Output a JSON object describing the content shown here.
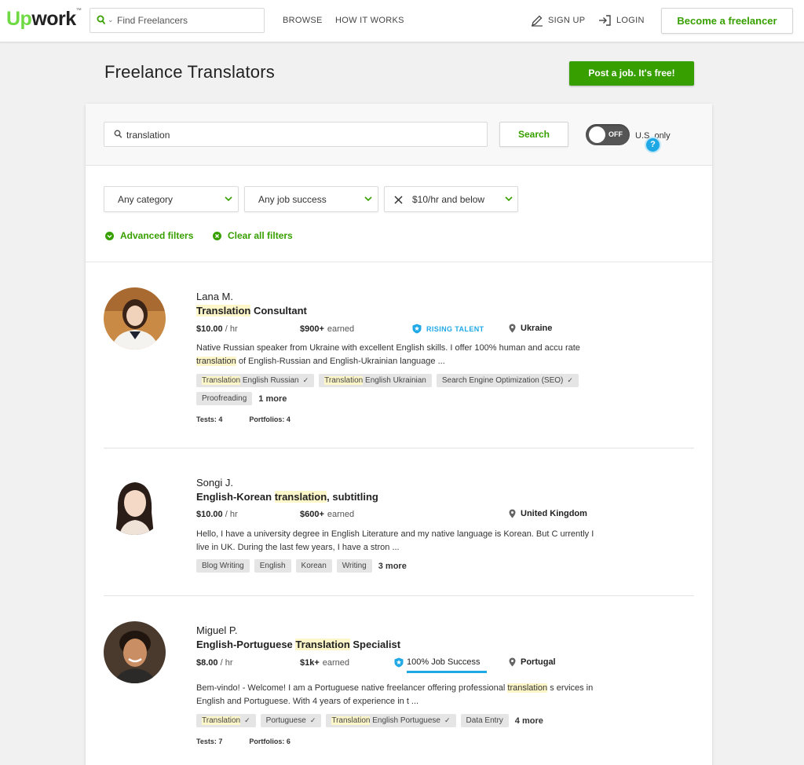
{
  "header": {
    "logo_up": "Up",
    "logo_work": "work",
    "logo_tm": "™",
    "search_placeholder": "Find Freelancers",
    "nav_browse": "BROWSE",
    "nav_how": "HOW IT WORKS",
    "signup": "SIGN UP",
    "login": "LOGIN",
    "become": "Become a freelancer"
  },
  "page": {
    "title": "Freelance Translators",
    "post_job": "Post a job. It's free!"
  },
  "search": {
    "value": "translation",
    "button": "Search",
    "toggle_state": "OFF",
    "us_only": "U.S. only",
    "help": "?"
  },
  "filters": {
    "category": "Any category",
    "job_success": "Any job success",
    "rate": "$10/hr and below",
    "advanced": "Advanced filters",
    "clear": "Clear all filters"
  },
  "freelancers": [
    {
      "name": "Lana M.",
      "title_hl": "Translation",
      "title_rest": " Consultant",
      "rate": "$10.00",
      "rate_unit": " / hr",
      "earned": "$900+",
      "earned_label": "earned",
      "badge": "RISING TALENT",
      "location": "Ukraine",
      "desc_a": "Native Russian speaker from Ukraine with excellent English skills. I offer 100% human and accu rate ",
      "desc_hl": "translation",
      "desc_b": " of English-Russian and English-Ukrainian language ...",
      "tags": [
        {
          "hl": "Translation",
          "rest": " English Russian",
          "check": "✓"
        },
        {
          "hl": "Translation",
          "rest": " English Ukrainian",
          "check": ""
        },
        {
          "hl": "",
          "rest": "Search Engine Optimization (SEO)",
          "check": "✓"
        },
        {
          "hl": "",
          "rest": "Proofreading",
          "check": ""
        }
      ],
      "more": "1 more",
      "tests": "Tests: 4",
      "portfolios": "Portfolios: 4"
    },
    {
      "name": "Songi J.",
      "title_pre": "English-Korean ",
      "title_hl": "translation",
      "title_rest": ", subtitling",
      "rate": "$10.00",
      "rate_unit": " / hr",
      "earned": "$600+",
      "earned_label": "earned",
      "location": "United Kingdom",
      "desc": "Hello, I have a university degree in English Literature and my native language is Korean. But C urrently I live in UK. During the last few years, I have a stron ...",
      "tags": [
        "Blog Writing",
        "English",
        "Korean",
        "Writing"
      ],
      "more": "3 more"
    },
    {
      "name": "Miguel P.",
      "title_pre": "English-Portuguese ",
      "title_hl": "Translation",
      "title_rest": " Specialist",
      "rate": "$8.00",
      "rate_unit": " / hr",
      "earned": "$1k+",
      "earned_label": "earned",
      "job_success": "100% Job Success",
      "location": "Portugal",
      "desc_a": "Bem-vindo! - Welcome! I am a Portuguese native freelancer offering professional ",
      "desc_hl": "translation",
      "desc_b": " s ervices in English and Portuguese. With 4 years of experience in t ...",
      "tags": [
        {
          "hl": "Translation",
          "rest": "",
          "check": "✓"
        },
        {
          "hl": "",
          "rest": "Portuguese",
          "check": "✓"
        },
        {
          "hl": "Translation",
          "rest": " English Portuguese",
          "check": "✓"
        },
        {
          "hl": "",
          "rest": "Data Entry",
          "check": ""
        }
      ],
      "more": "4 more",
      "tests": "Tests: 7",
      "portfolios": "Portfolios: 6"
    }
  ],
  "colors": {
    "brand_green": "#37a000",
    "logo_green": "#6fda44",
    "accent_blue": "#1fa8e6",
    "highlight": "#fcf6c9"
  }
}
